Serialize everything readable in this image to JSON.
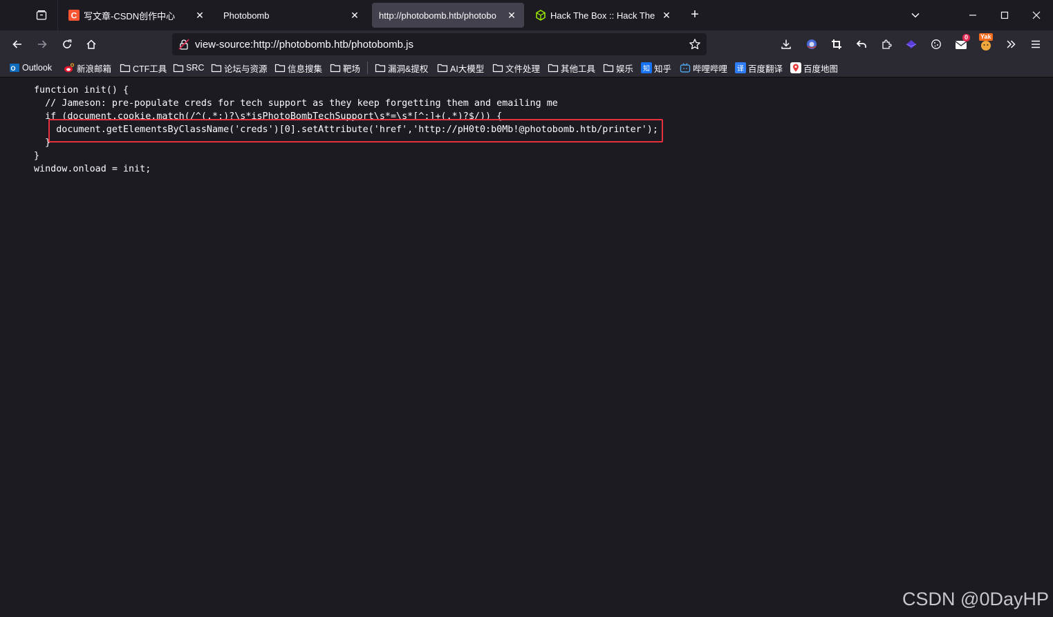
{
  "tabs": [
    {
      "title": "写文章-CSDN创作中心",
      "favicon": "csdn-icon",
      "active": false
    },
    {
      "title": "Photobomb",
      "favicon": "none",
      "active": false
    },
    {
      "title": "http://photobomb.htb/photobo",
      "favicon": "none",
      "active": true
    },
    {
      "title": "Hack The Box :: Hack The Bo",
      "favicon": "htb-cube-icon",
      "active": false
    }
  ],
  "tab_close_symbol": "✕",
  "new_tab_symbol": "+",
  "urlbar": {
    "url": "view-source:http://photobomb.htb/photobomb.js"
  },
  "bookmarks": [
    {
      "label": "Outlook",
      "icon": "outlook-icon"
    },
    {
      "label": "新浪邮箱",
      "icon": "sina-icon"
    },
    {
      "label": "CTF工具",
      "icon": "folder-icon"
    },
    {
      "label": "SRC",
      "icon": "folder-icon"
    },
    {
      "label": "论坛与资源",
      "icon": "folder-icon"
    },
    {
      "label": "信息搜集",
      "icon": "folder-icon"
    },
    {
      "label": "靶场",
      "icon": "folder-icon"
    },
    {
      "label": "漏洞&提权",
      "icon": "folder-icon"
    },
    {
      "label": "AI大模型",
      "icon": "folder-icon"
    },
    {
      "label": "文件处理",
      "icon": "folder-icon"
    },
    {
      "label": "其他工具",
      "icon": "folder-icon"
    },
    {
      "label": "娱乐",
      "icon": "folder-icon"
    },
    {
      "label": "知乎",
      "icon": "zhihu-icon"
    },
    {
      "label": "哔哩哔哩",
      "icon": "bilibili-icon"
    },
    {
      "label": "百度翻译",
      "icon": "baidu-translate-icon"
    },
    {
      "label": "百度地图",
      "icon": "baidu-map-icon"
    }
  ],
  "source": {
    "lines": [
      "function init() {",
      "  // Jameson: pre-populate creds for tech support as they keep forgetting them and emailing me",
      "  if (document.cookie.match(/^(.*;)?\\s*isPhotoBombTechSupport\\s*=\\s*[^;]+(.*)?$/)) {",
      "    document.getElementsByClassName('creds')[0].setAttribute('href','http://pH0t0:b0Mb!@photobomb.htb/printer');",
      "  }",
      "}",
      "window.onload = init;"
    ]
  },
  "toolbar_badges": {
    "mail_count": "0",
    "yak_label": "Yak"
  },
  "watermark": "CSDN @0DayHP",
  "colors": {
    "highlight_border": "#e8303f",
    "csdn_red": "#fc5531",
    "htb_green": "#9fef00"
  }
}
